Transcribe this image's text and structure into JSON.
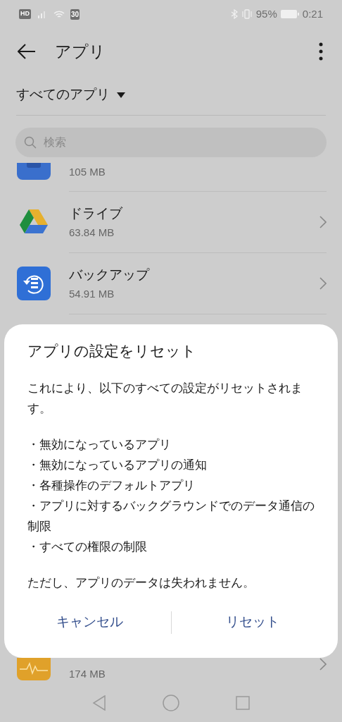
{
  "status_bar": {
    "hd": "HD",
    "badge": "30",
    "battery": "95%",
    "time": "0:21"
  },
  "header": {
    "title": "アプリ"
  },
  "filter": {
    "label": "すべてのアプリ"
  },
  "search": {
    "placeholder": "検索"
  },
  "top_partial_app": {
    "kind": "folder",
    "size": "105 MB"
  },
  "apps": [
    {
      "kind": "drive",
      "name": "ドライブ",
      "size": "63.84 MB"
    },
    {
      "kind": "backup",
      "name": "バックアップ",
      "size": "54.91 MB"
    }
  ],
  "bottom_partial_app": {
    "kind": "health",
    "size": "174 MB"
  },
  "dialog": {
    "title": "アプリの設定をリセット",
    "intro": "これにより、以下のすべての設定がリセットされます。",
    "bullets": [
      "・無効になっているアプリ",
      "・無効になっているアプリの通知",
      "・各種操作のデフォルトアプリ",
      "・アプリに対するバックグラウンドでのデータ通信の制限",
      "・すべての権限の制限"
    ],
    "note": "ただし、アプリのデータは失われません。",
    "buttons": [
      "キャンセル",
      "リセット"
    ]
  }
}
